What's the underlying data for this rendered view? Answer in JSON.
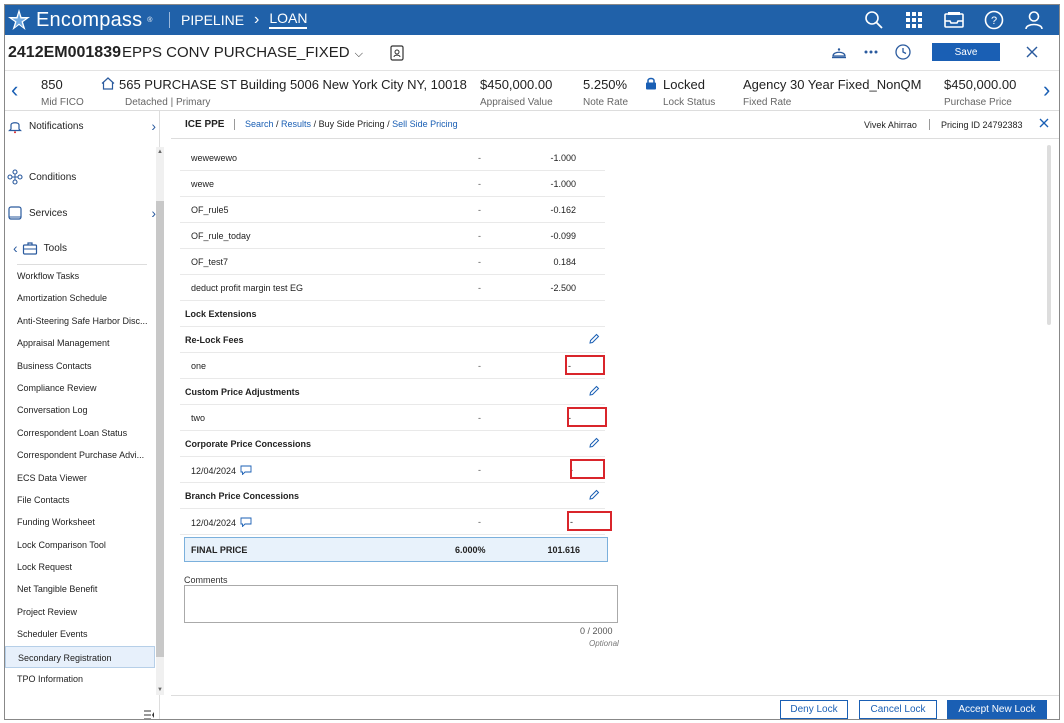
{
  "app": {
    "name": "Encompass",
    "nav": {
      "pipeline": "PIPELINE",
      "loan": "LOAN"
    }
  },
  "loan": {
    "number": "2412EM001839",
    "name": "EPPS CONV PURCHASE_FIXED",
    "save_label": "Save"
  },
  "strip": {
    "fico_value": "850",
    "fico_label": "Mid FICO",
    "address_value": "565 PURCHASE ST Building 5006 New York City NY, 10018",
    "address_label": "Detached | Primary",
    "appraised_value": "$450,000.00",
    "appraised_label": "Appraised Value",
    "note_rate_value": "5.250%",
    "note_rate_label": "Note Rate",
    "lock_value": "Locked",
    "lock_label": "Lock Status",
    "program_value": "Agency 30 Year Fixed_NonQM",
    "program_label": "Fixed Rate",
    "purchase_value": "$450,000.00",
    "purchase_label": "Purchase Price"
  },
  "sidebar": {
    "notifications": "Notifications",
    "conditions": "Conditions",
    "services": "Services",
    "tools": "Tools",
    "tool_items": [
      "Workflow Tasks",
      "Amortization Schedule",
      "Anti-Steering Safe Harbor Disc...",
      "Appraisal Management",
      "Business Contacts",
      "Compliance Review",
      "Conversation Log",
      "Correspondent Loan Status",
      "Correspondent Purchase Advi...",
      "ECS Data Viewer",
      "File Contacts",
      "Funding Worksheet",
      "Lock Comparison Tool",
      "Lock Request",
      "Net Tangible Benefit",
      "Project Review",
      "Scheduler Events",
      "Secondary Registration",
      "TPO Information"
    ],
    "selected_tool": "Secondary Registration"
  },
  "panel": {
    "title": "ICE PPE",
    "crumb_search": "Search",
    "crumb_results": "Results",
    "crumb_buy": "Buy Side Pricing",
    "crumb_sell": "Sell Side Pricing",
    "crumb_sep": " / ",
    "user": "Vivek Ahirrao",
    "pricing_id": "Pricing ID 24792383"
  },
  "adjustments": [
    {
      "name": "wewewewo",
      "dash": "-",
      "value": "-1.000"
    },
    {
      "name": "wewe",
      "dash": "-",
      "value": "-1.000"
    },
    {
      "name": "OF_rule5",
      "dash": "-",
      "value": "-0.162"
    },
    {
      "name": "OF_rule_today",
      "dash": "-",
      "value": "-0.099"
    },
    {
      "name": "OF_test7",
      "dash": "-",
      "value": "0.184"
    },
    {
      "name": "deduct profit margin test EG",
      "dash": "-",
      "value": "-2.500"
    }
  ],
  "sections": {
    "lock_extensions": "Lock Extensions",
    "relock_fees": {
      "title": "Re-Lock Fees",
      "item": "one",
      "dash": "-",
      "value": "-"
    },
    "custom_price": {
      "title": "Custom Price Adjustments",
      "item": "two",
      "dash": "-",
      "value": "-"
    },
    "corporate": {
      "title": "Corporate Price Concessions",
      "item": "12/04/2024",
      "dash": "-",
      "value": "-"
    },
    "branch": {
      "title": "Branch Price Concessions",
      "item": "12/04/2024",
      "dash": "-",
      "value": "-"
    }
  },
  "final_price": {
    "label": "FINAL PRICE",
    "rate": "6.000%",
    "price": "101.616"
  },
  "comments": {
    "label": "Comments",
    "value": "",
    "count": "0 / 2000",
    "optional": "Optional"
  },
  "footer": {
    "deny": "Deny Lock",
    "cancel": "Cancel Lock",
    "accept": "Accept New Lock"
  },
  "colors": {
    "brand": "#2061a9",
    "accent": "#1a5fb4",
    "highlight": "#d9252b"
  }
}
